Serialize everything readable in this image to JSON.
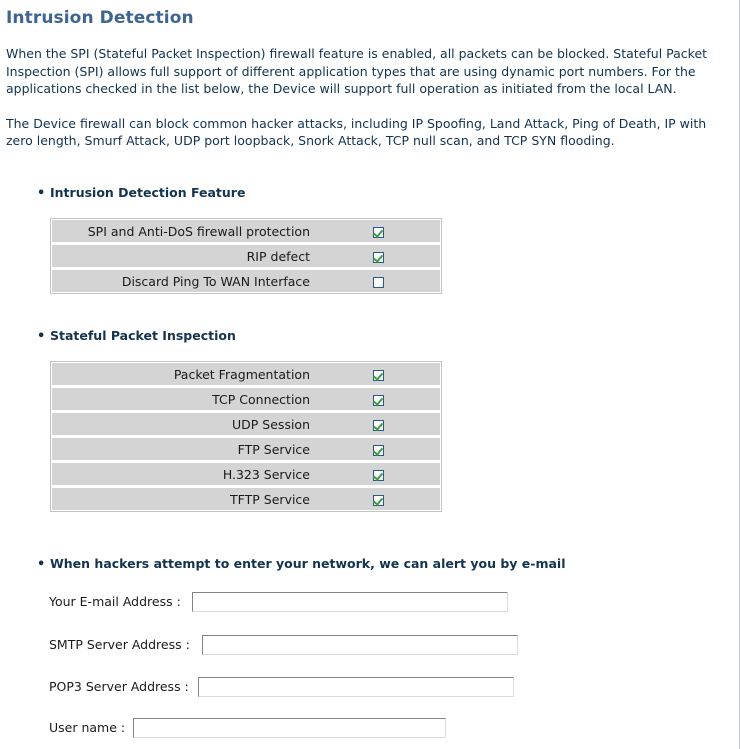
{
  "page": {
    "title": "Intrusion Detection",
    "intro_paragraph_1": "When the SPI (Stateful Packet Inspection) firewall feature is enabled, all packets can be blocked.  Stateful Packet Inspection (SPI) allows full support of different application types that are using dynamic port numbers.  For the applications checked in the list below, the Device will support full operation as initiated from the local LAN.",
    "intro_paragraph_2": "The Device firewall can block common hacker attacks, including IP Spoofing, Land Attack, Ping of Death, IP with zero length, Smurf Attack, UDP port loopback, Snork Attack, TCP null scan, and TCP SYN flooding."
  },
  "colors": {
    "title": "#3e6590",
    "heading": "#13334f",
    "body_text": "#13334f",
    "cell_background": "#d4d4d4",
    "check_mark": "#3f9c3f",
    "checkbox_border": "#2c5a86"
  },
  "intrusion_detection_feature": {
    "heading": "Intrusion Detection Feature",
    "bullet": "•",
    "rows": [
      {
        "label": "SPI and Anti-DoS firewall protection",
        "checked": true
      },
      {
        "label": "RIP defect",
        "checked": true
      },
      {
        "label": "Discard Ping To WAN Interface",
        "checked": false
      }
    ]
  },
  "stateful_packet_inspection": {
    "heading": "Stateful Packet Inspection",
    "bullet": "•",
    "rows": [
      {
        "label": "Packet Fragmentation",
        "checked": true
      },
      {
        "label": "TCP Connection",
        "checked": true
      },
      {
        "label": "UDP Session",
        "checked": true
      },
      {
        "label": "FTP Service",
        "checked": true
      },
      {
        "label": "H.323 Service",
        "checked": true
      },
      {
        "label": "TFTP  Service",
        "checked": true
      }
    ]
  },
  "email_alert": {
    "heading": "When hackers attempt to enter your network, we can alert you by e-mail",
    "bullet": "•",
    "fields": [
      {
        "label": "Your E-mail Address :",
        "value": "",
        "placeholder": ""
      },
      {
        "label": "SMTP Server Address :",
        "value": "",
        "placeholder": ""
      },
      {
        "label": "POP3 Server Address :",
        "value": "",
        "placeholder": ""
      },
      {
        "label": "User name :",
        "value": "",
        "placeholder": ""
      }
    ]
  }
}
